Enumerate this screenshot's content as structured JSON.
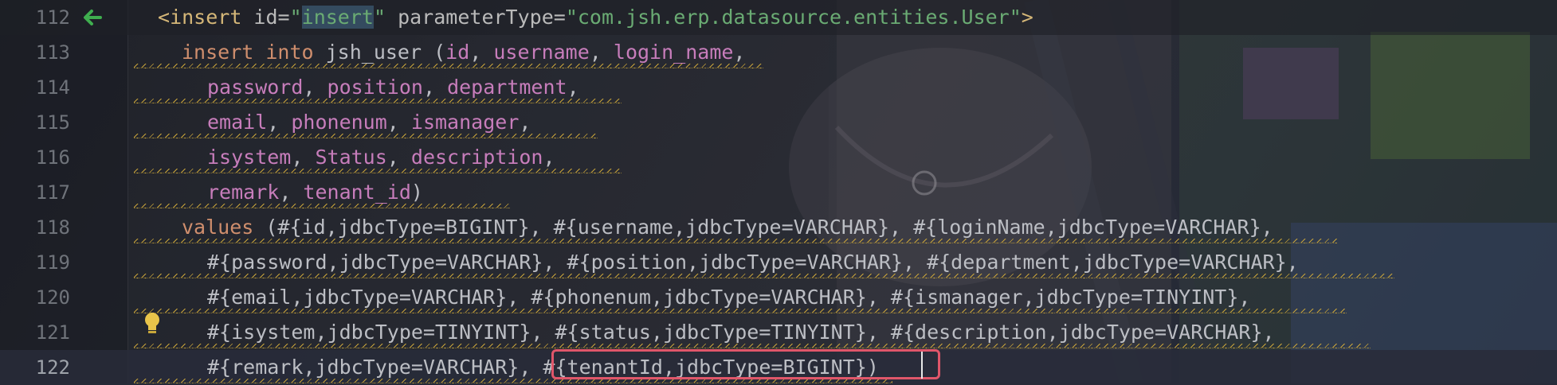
{
  "editor": {
    "lines": [
      {
        "number": "112",
        "parts": [
          {
            "t": "<",
            "c": "t-tag"
          },
          {
            "t": "insert",
            "c": "t-tag"
          },
          {
            "t": " id=",
            "c": "t-attr"
          },
          {
            "t": "\"",
            "c": "t-str"
          },
          {
            "t": "insert",
            "c": "t-str-hl"
          },
          {
            "t": "\"",
            "c": "t-str"
          },
          {
            "t": " parameterType=",
            "c": "t-attr"
          },
          {
            "t": "\"com.jsh.erp.datasource.entities.User\"",
            "c": "t-str"
          },
          {
            "t": ">",
            "c": "t-tag"
          }
        ]
      },
      {
        "number": "113",
        "parts": [
          {
            "t": "insert into",
            "c": "t-kw"
          },
          {
            "t": " jsh_user (",
            "c": "t-plain"
          },
          {
            "t": "id",
            "c": "t-col"
          },
          {
            "t": ", ",
            "c": "t-plain"
          },
          {
            "t": "username",
            "c": "t-col"
          },
          {
            "t": ", ",
            "c": "t-plain"
          },
          {
            "t": "login_name",
            "c": "t-col"
          },
          {
            "t": ",",
            "c": "t-plain"
          }
        ]
      },
      {
        "number": "114",
        "parts": [
          {
            "t": "password",
            "c": "t-col"
          },
          {
            "t": ", ",
            "c": "t-plain"
          },
          {
            "t": "position",
            "c": "t-col"
          },
          {
            "t": ", ",
            "c": "t-plain"
          },
          {
            "t": "department",
            "c": "t-col"
          },
          {
            "t": ",",
            "c": "t-plain"
          }
        ]
      },
      {
        "number": "115",
        "parts": [
          {
            "t": "email",
            "c": "t-col"
          },
          {
            "t": ", ",
            "c": "t-plain"
          },
          {
            "t": "phonenum",
            "c": "t-col"
          },
          {
            "t": ", ",
            "c": "t-plain"
          },
          {
            "t": "ismanager",
            "c": "t-col"
          },
          {
            "t": ",",
            "c": "t-plain"
          }
        ]
      },
      {
        "number": "116",
        "parts": [
          {
            "t": "isystem",
            "c": "t-col"
          },
          {
            "t": ", ",
            "c": "t-plain"
          },
          {
            "t": "Status",
            "c": "t-col"
          },
          {
            "t": ", ",
            "c": "t-plain"
          },
          {
            "t": "description",
            "c": "t-col"
          },
          {
            "t": ",",
            "c": "t-plain"
          }
        ]
      },
      {
        "number": "117",
        "parts": [
          {
            "t": "remark",
            "c": "t-col"
          },
          {
            "t": ", ",
            "c": "t-plain"
          },
          {
            "t": "tenant_id",
            "c": "t-col"
          },
          {
            "t": ")",
            "c": "t-plain"
          }
        ]
      },
      {
        "number": "118",
        "parts": [
          {
            "t": "values",
            "c": "t-kw"
          },
          {
            "t": " (#{id,jdbcType=BIGINT}, #{username,jdbcType=VARCHAR}, #{loginName,jdbcType=VARCHAR},",
            "c": "t-param"
          }
        ]
      },
      {
        "number": "119",
        "parts": [
          {
            "t": "#{password,jdbcType=VARCHAR}, #{position,jdbcType=VARCHAR}, #{department,jdbcType=VARCHAR},",
            "c": "t-param"
          }
        ]
      },
      {
        "number": "120",
        "parts": [
          {
            "t": "#{email,jdbcType=VARCHAR}, #{phonenum,jdbcType=VARCHAR}, #{ismanager,jdbcType=TINYINT},",
            "c": "t-param"
          }
        ]
      },
      {
        "number": "121",
        "parts": [
          {
            "t": "#{isystem,jdbcType=TINYINT}, #{status,jdbcType=TINYINT}, #{description,jdbcType=VARCHAR},",
            "c": "t-param"
          }
        ]
      },
      {
        "number": "122",
        "parts": [
          {
            "t": "#{remark,jdbcType=VARCHAR}, #{tenantId,jdbcType=BIGINT})",
            "c": "t-param"
          }
        ]
      }
    ]
  },
  "icons": {
    "gutter_arrow": "arrow-left-icon",
    "intention": "lightbulb-icon"
  },
  "colors": {
    "highlight_box": "#e0566a",
    "warning_squiggle": "#c7a33a",
    "gutter_arrow": "#3fae4f"
  }
}
